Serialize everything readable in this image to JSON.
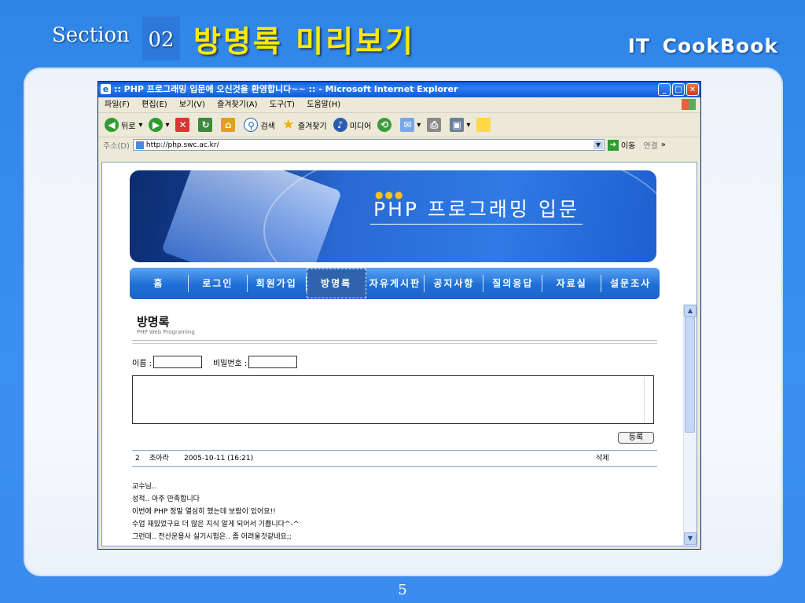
{
  "slide": {
    "section_label": "Section",
    "section_number": "02",
    "title": "방명록 미리보기",
    "brand": "IT CookBook",
    "page_number": "5"
  },
  "browser": {
    "window_title": ":: PHP 프로그래밍 입문에 오신것을 환영합니다~~ :: - Microsoft Internet Explorer",
    "menu": [
      "파일(F)",
      "편집(E)",
      "보기(V)",
      "즐겨찾기(A)",
      "도구(T)",
      "도움말(H)"
    ],
    "toolbar": {
      "back": "뒤로",
      "search": "검색",
      "favorites": "즐겨찾기",
      "media": "미디어"
    },
    "address_label": "주소(D)",
    "address": "http://php.swc.ac.kr/",
    "go": "이동",
    "links": "연결"
  },
  "site": {
    "banner_title": "PHP 프로그래밍 입문",
    "nav": [
      "홈",
      "로그인",
      "회원가입",
      "방명록",
      "자유게시판",
      "공지사항",
      "질의응답",
      "자료실",
      "설문조사"
    ],
    "active_nav": "방명록"
  },
  "guestbook": {
    "title": "방명록",
    "subtitle": "PHP Web Programing",
    "name_label": "이름 :",
    "password_label": "비밀번호 :",
    "name_value": "",
    "password_value": "",
    "submit_label": "등록",
    "entry": {
      "number": "2",
      "author": "조아라",
      "date": "2005-10-11 (16:21)",
      "delete": "삭제",
      "lines": [
        "교수님..",
        "성적.. 아주 만족합니다",
        "이번에 PHP 정말 열심히 했는데 보람이 있어요!!",
        "수업 재밌었구요 더 많은 지식 알게 되어서 기쁩니다^-^",
        "그런데.. 전산운용사 실기시험은.. 좀 어려울것같네요;;"
      ]
    }
  }
}
